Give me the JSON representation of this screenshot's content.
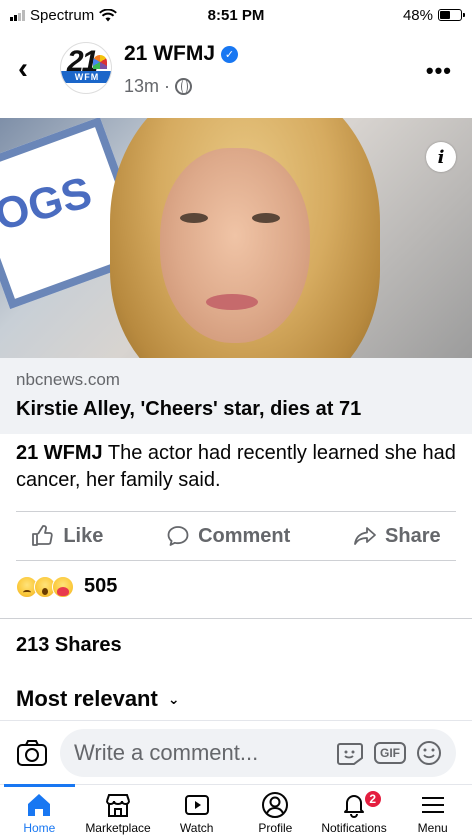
{
  "status_bar": {
    "carrier": "Spectrum",
    "time": "8:51 PM",
    "battery": "48%",
    "battery_level": 0.48
  },
  "header": {
    "page_name": "21 WFMJ",
    "logo_number": "21",
    "logo_text": "WFM",
    "timestamp": "13m",
    "separator": "·"
  },
  "link_preview": {
    "domain": "nbcnews.com",
    "headline": "Kirstie Alley, 'Cheers' star, dies at 71",
    "info_glyph": "i",
    "sign_text": "OGS"
  },
  "post": {
    "author": "21 WFMJ",
    "text": "The actor had recently learned she had cancer, her family said."
  },
  "actions": {
    "like": "Like",
    "comment": "Comment",
    "share": "Share"
  },
  "engagement": {
    "reaction_icons": [
      "sad-emoji-icon",
      "wow-emoji-icon",
      "care-emoji-icon"
    ],
    "reaction_count": "505",
    "shares": "213 Shares",
    "sort_label": "Most relevant"
  },
  "comment_bar": {
    "placeholder": "Write a comment...",
    "gif_label": "GIF"
  },
  "tabs": [
    {
      "label": "Home",
      "active": true
    },
    {
      "label": "Marketplace"
    },
    {
      "label": "Watch"
    },
    {
      "label": "Profile"
    },
    {
      "label": "Notifications",
      "badge": "2"
    },
    {
      "label": "Menu"
    }
  ],
  "colors": {
    "accent": "#1877f2",
    "secondary_text": "#65676b",
    "badge": "#e41e3f",
    "preview_bg": "#f0f2f5"
  }
}
